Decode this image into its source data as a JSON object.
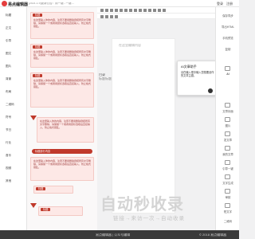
{
  "app": {
    "name": "易点编辑器",
    "tip": "[2021.1.9]更新公告：用一键...一键...."
  },
  "topbar_right": [
    "登录",
    "注册"
  ],
  "left_sidebar": [
    "标题",
    "正文",
    "引导",
    "图文",
    "图片",
    "背景",
    "布局",
    "二维码",
    "符号",
    "节日",
    "行业",
    "音乐",
    "视频",
    "其他"
  ],
  "templates": {
    "body_text": "在这里输入你的内容，注意不要用删除键把所有文字删除，请保留一个或者用鼠标选取后直接输入，防止格式错乱。",
    "header_labels": [
      "标题",
      "标题",
      "标题",
      "标题",
      "标题"
    ],
    "highlight_label": "标题部分内容"
  },
  "editor": {
    "placeholder": "在这里编辑内容",
    "toc_label": "目录",
    "toc_sub": "标题标题"
  },
  "ai_popup": {
    "title": "AI文章助手",
    "text": "请在输入框中输入您想要创作的文章主题。",
    "send_icon": "send-icon"
  },
  "right_panel": [
    "保存同步",
    "导出HTML",
    "手机预览",
    "复制",
    "文章封面",
    "图片",
    "发文章",
    "我的文章",
    "引导一键",
    "AI",
    "文字生成",
    "审核",
    "短文字",
    "二维码"
  ],
  "watermark": {
    "title": "自动秒收录",
    "subtitle": "链接→来访一次→自动收录"
  },
  "footer": {
    "left": "易点编辑器 | 公众号编辑",
    "right": "© 2018 易点编辑器"
  }
}
